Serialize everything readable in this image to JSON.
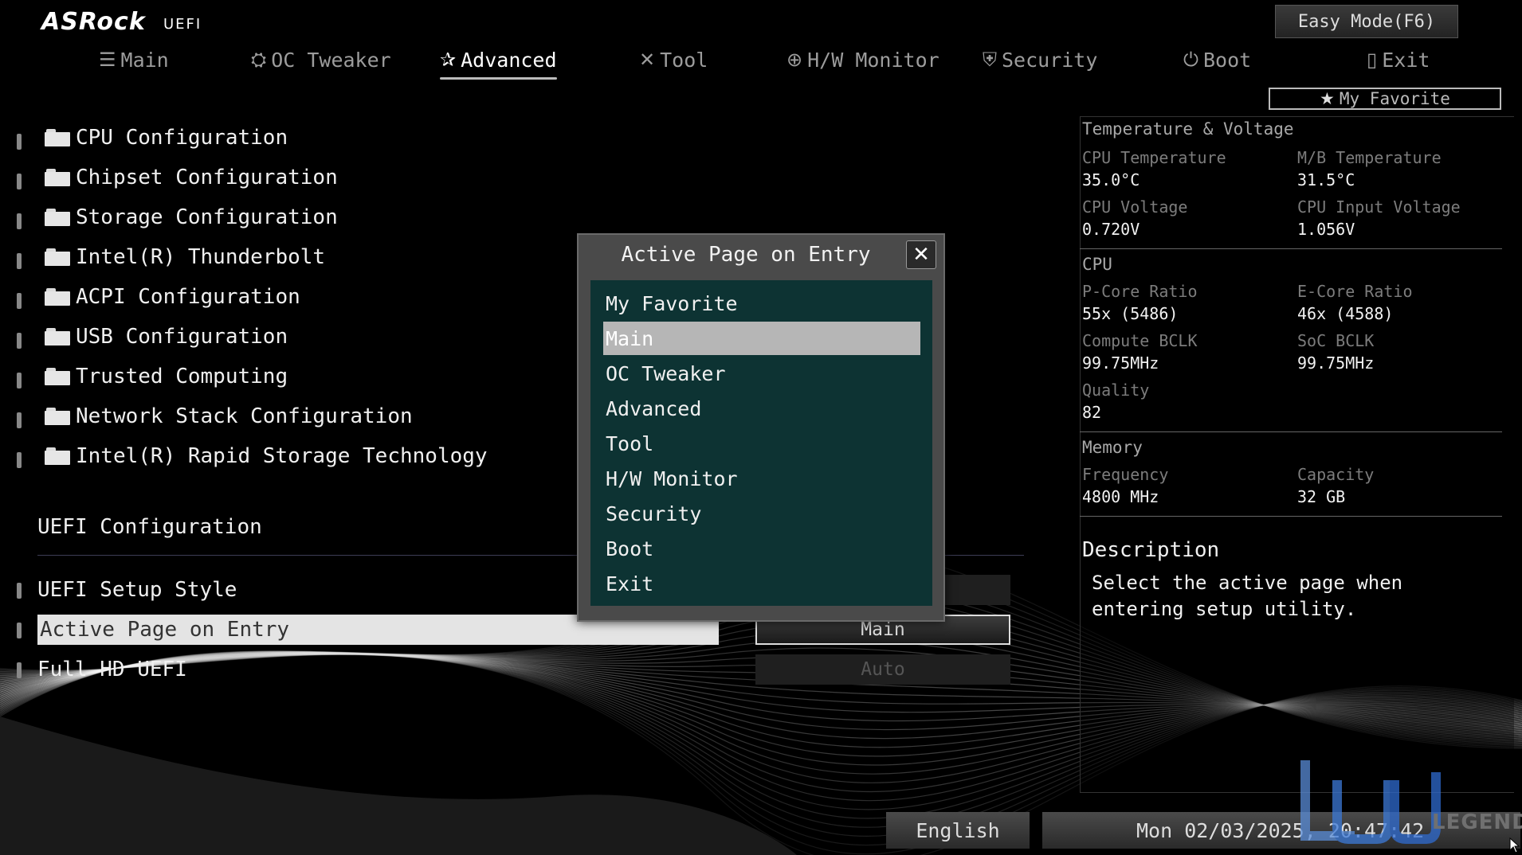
{
  "header": {
    "brand": "ASRock",
    "brand_sub": "UEFI",
    "easy_mode_label": "Easy Mode(F6)",
    "my_favorite_label": "My Favorite"
  },
  "tabs": [
    {
      "label": "Main",
      "icon": "list-icon",
      "active": false
    },
    {
      "label": "OC Tweaker",
      "icon": "rocket-icon",
      "active": false
    },
    {
      "label": "Advanced",
      "icon": "star-icon",
      "active": true
    },
    {
      "label": "Tool",
      "icon": "tools-icon",
      "active": false
    },
    {
      "label": "H/W Monitor",
      "icon": "crosshair-icon",
      "active": false
    },
    {
      "label": "Security",
      "icon": "shield-icon",
      "active": false
    },
    {
      "label": "Boot",
      "icon": "power-icon",
      "active": false
    },
    {
      "label": "Exit",
      "icon": "exit-door-icon",
      "active": false
    }
  ],
  "menu": [
    {
      "label": "CPU Configuration"
    },
    {
      "label": "Chipset Configuration"
    },
    {
      "label": "Storage Configuration"
    },
    {
      "label": "Intel(R) Thunderbolt"
    },
    {
      "label": "ACPI Configuration"
    },
    {
      "label": "USB Configuration"
    },
    {
      "label": "Trusted Computing"
    },
    {
      "label": "Network Stack Configuration"
    },
    {
      "label": "Intel(R) Rapid Storage Technology"
    }
  ],
  "uefi_section": {
    "title": "UEFI Configuration",
    "settings": [
      {
        "label": "UEFI Setup Style",
        "value": ""
      },
      {
        "label": "Active Page on Entry",
        "value": "Main",
        "selected": true
      },
      {
        "label": "Full HD UEFI",
        "value": "Auto"
      }
    ]
  },
  "right_panel": {
    "temp_voltage": {
      "title": "Temperature & Voltage",
      "cpu_temp_label": "CPU Temperature",
      "cpu_temp_value": "35.0°C",
      "mb_temp_label": "M/B Temperature",
      "mb_temp_value": "31.5°C",
      "cpu_voltage_label": "CPU Voltage",
      "cpu_voltage_value": "0.720V",
      "cpu_input_voltage_label": "CPU Input Voltage",
      "cpu_input_voltage_value": "1.056V"
    },
    "cpu": {
      "title": "CPU",
      "pcore_label": "P-Core Ratio",
      "pcore_value": "55x (5486)",
      "ecore_label": "E-Core Ratio",
      "ecore_value": "46x (4588)",
      "compute_bclk_label": "Compute BCLK",
      "compute_bclk_value": "99.75MHz",
      "soc_bclk_label": "SoC BCLK",
      "soc_bclk_value": "99.75MHz",
      "quality_label": "Quality",
      "quality_value": "82"
    },
    "memory": {
      "title": "Memory",
      "frequency_label": "Frequency",
      "frequency_value": "4800 MHz",
      "capacity_label": "Capacity",
      "capacity_value": "32 GB"
    },
    "description": {
      "title": "Description",
      "text": "Select the active page when entering setup utility."
    }
  },
  "modal": {
    "title": "Active Page on Entry",
    "options": [
      "My Favorite",
      "Main",
      "OC Tweaker",
      "Advanced",
      "Tool",
      "H/W Monitor",
      "Security",
      "Boot",
      "Exit"
    ],
    "selected": "Main"
  },
  "footer": {
    "language": "English",
    "datetime": "Mon 02/03/2025, 20:47:42"
  },
  "watermark": {
    "text": "LEGEND"
  },
  "colors": {
    "background": "#000000",
    "modal_list_bg": "#0d3333",
    "selected_option_bg": "#b6b6b6",
    "selected_row_bg": "#e4e4e4"
  }
}
